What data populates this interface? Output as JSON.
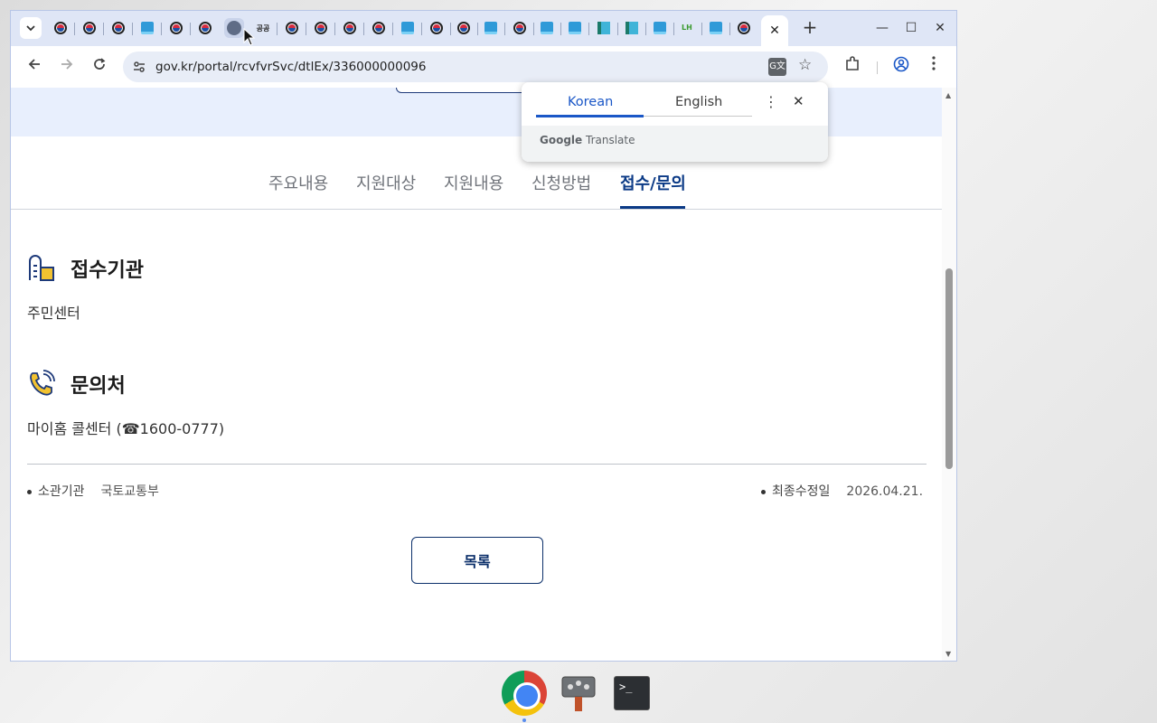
{
  "browser": {
    "url": "gov.kr/portal/rcvfvrSvc/dtlEx/336000000096",
    "tab_favicons": [
      "flag-icon",
      "flag-icon",
      "flag-icon",
      "blue-doc-icon",
      "flag-icon",
      "flag-icon",
      "globe-icon",
      "gov-icon",
      "flag-icon",
      "flag-icon",
      "flag-icon",
      "blue-doc-icon",
      "flag-icon",
      "flag-icon",
      "blue-doc-icon",
      "flag-icon",
      "blue-doc-icon",
      "blue-doc-icon",
      "green-icon",
      "green-icon",
      "blue-doc-icon",
      "lh-icon",
      "blue-doc-icon",
      "flag-icon"
    ],
    "gov_favicon_text": "공공",
    "lh_favicon_text": "LH"
  },
  "page": {
    "tabs": [
      {
        "label": "주요내용"
      },
      {
        "label": "지원대상"
      },
      {
        "label": "지원내용"
      },
      {
        "label": "신청방법"
      },
      {
        "label": "접수/문의"
      }
    ],
    "active_tab": "접수/문의",
    "sections": [
      {
        "title": "접수기관",
        "text": "주민센터"
      },
      {
        "title": "문의처",
        "text": "마이홈 콜센터 (☎1600-0777)"
      }
    ],
    "meta": {
      "agency_label": "소관기관",
      "agency_value": "국토교통부",
      "updated_label": "최종수정일",
      "updated_value": "2026.04.21."
    },
    "list_button": "목록"
  },
  "translate_popup": {
    "lang_source": "Korean",
    "lang_target": "English",
    "brand_google": "Google",
    "brand_translate": "Translate"
  },
  "colors": {
    "accent": "#0b3a86",
    "translate_accent": "#1a57c7",
    "hero_bg": "#e8effd"
  }
}
